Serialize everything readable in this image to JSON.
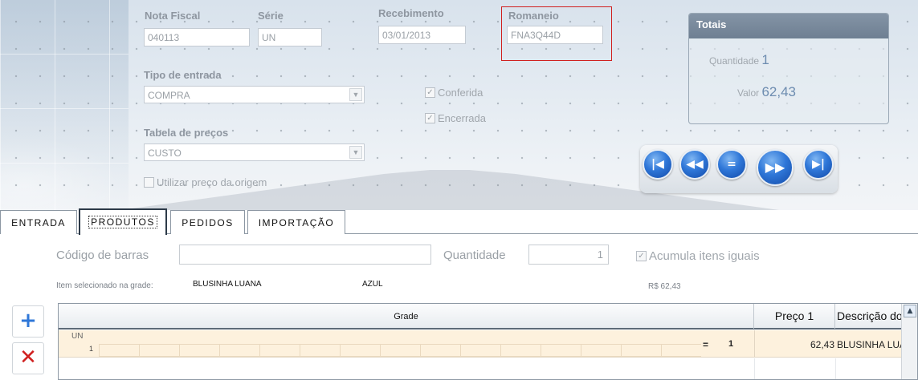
{
  "header": {
    "nota_fiscal": {
      "label": "Nota Fiscal",
      "value": "040113"
    },
    "serie": {
      "label": "Série",
      "value": "UN"
    },
    "recebimento": {
      "label": "Recebimento",
      "value": "03/01/2013"
    },
    "romaneio": {
      "label": "Romaneio",
      "value": "FNA3Q44D"
    },
    "tipo_entrada": {
      "label": "Tipo de entrada",
      "value": "COMPRA"
    },
    "tabela_precos": {
      "label": "Tabela de preços",
      "value": "CUSTO"
    },
    "utilizar_preco": {
      "label": "Utilizar preço da origem",
      "checked": false
    },
    "conferida": {
      "label": "Conferida",
      "checked": true
    },
    "encerrada": {
      "label": "Encerrada",
      "checked": true
    }
  },
  "totais": {
    "title": "Totais",
    "quantidade_label": "Quantidade",
    "quantidade_value": "1",
    "valor_label": "Valor",
    "valor_value": "62,43"
  },
  "navigation": {
    "buttons": [
      "first-icon",
      "previous-icon",
      "equals-icon",
      "next-icon",
      "last-icon"
    ]
  },
  "tabs": [
    {
      "label": "ENTRADA",
      "active": false
    },
    {
      "label": "PRODUTOS",
      "active": true
    },
    {
      "label": "PEDIDOS",
      "active": false
    },
    {
      "label": "IMPORTAÇÃO",
      "active": false
    }
  ],
  "produtos": {
    "codigo_barras_label": "Código de barras",
    "codigo_barras_value": "",
    "quantidade_label": "Quantidade",
    "quantidade_value": "1",
    "acumula_label": "Acumula itens iguais",
    "acumula_checked": true,
    "item_selecionado_label": "Item selecionado na grade:",
    "item_nome": "BLUSINHA LUANA",
    "item_cor": "AZUL",
    "item_preco": "R$ 62,43"
  },
  "grid": {
    "columns": [
      "Grade",
      "Preço 1",
      "Descrição do"
    ],
    "row": {
      "grade_label": "UN",
      "grade_qty": "1",
      "equals": "=",
      "qty": "1",
      "preco": "62,43",
      "descricao": "BLUSINHA LUA"
    }
  },
  "colors": {
    "accent": "#2f77d8",
    "highlight_border": "#d0201f",
    "row_bg": "#fdf1dd"
  }
}
